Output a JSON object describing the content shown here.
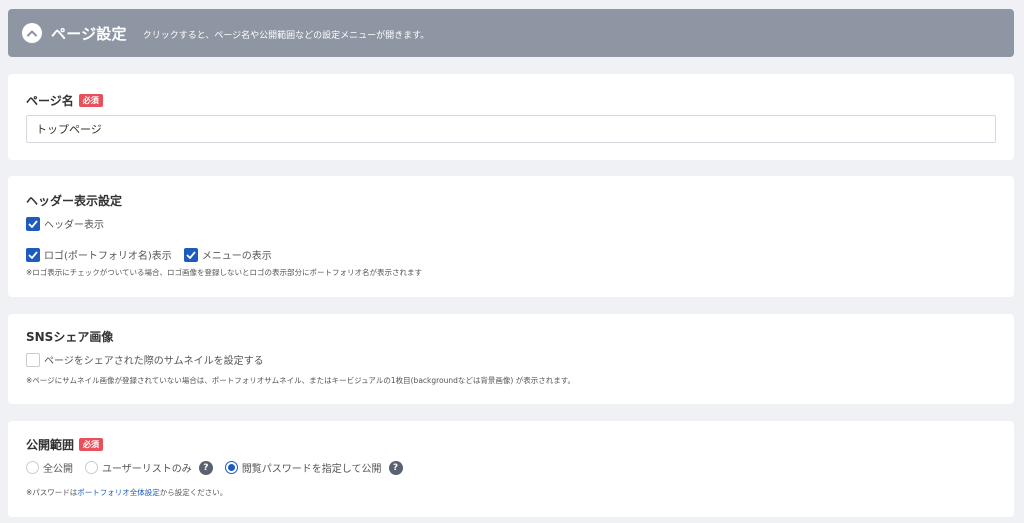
{
  "header": {
    "title": "ページ設定",
    "hint": "クリックすると、ページ名や公開範囲などの設定メニューが開きます。"
  },
  "page_name": {
    "label": "ページ名",
    "required": "必須",
    "value": "トップページ"
  },
  "header_display": {
    "label": "ヘッダー表示設定",
    "show_header": "ヘッダー表示",
    "show_logo": "ロゴ(ポートフォリオ名)表示",
    "show_menu": "メニューの表示",
    "note": "※ロゴ表示にチェックがついている場合、ロゴ画像を登録しないとロゴの表示部分にポートフォリオ名が表示されます"
  },
  "sns": {
    "label": "SNSシェア画像",
    "option": "ページをシェアされた際のサムネイルを設定する",
    "note": "※ページにサムネイル画像が登録されていない場合は、ポートフォリオサムネイル、またはキービジュアルの1枚目(backgroundなどは背景画像) が表示されます。"
  },
  "visibility": {
    "label": "公開範囲",
    "required": "必須",
    "options": [
      "全公開",
      "ユーザーリストのみ",
      "閲覧パスワードを指定して公開"
    ],
    "selected": 2,
    "note_prefix": "※パスワードは",
    "note_link": "ポートフォリオ全体設定",
    "note_suffix": "から設定ください。"
  }
}
